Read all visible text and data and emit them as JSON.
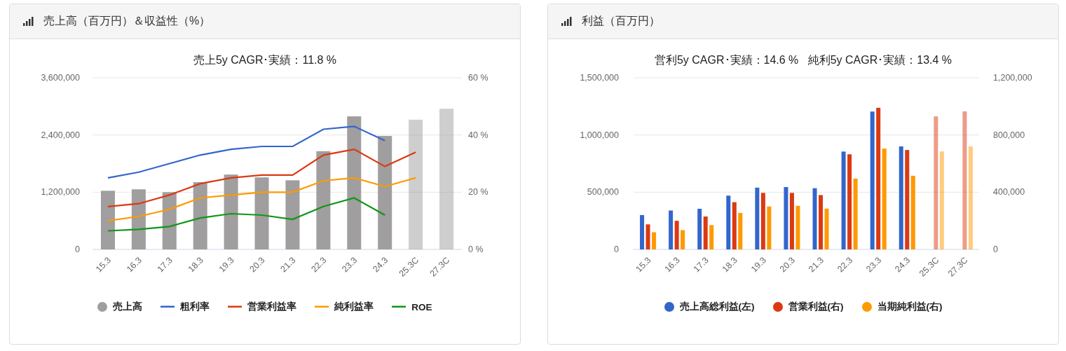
{
  "panels": [
    {
      "title": "売上高（百万円）＆収益性（%）",
      "forecast": [
        false,
        false,
        false,
        false,
        false,
        false,
        false,
        false,
        false,
        false,
        true,
        true
      ],
      "chart_data": {
        "type": "bar",
        "stacked": false,
        "title": "売上5y CAGR･実績：11.8 %",
        "categories": [
          "15.3",
          "16.3",
          "17.3",
          "18.3",
          "19.3",
          "20.3",
          "21.3",
          "22.3",
          "23.3",
          "24.3",
          "25.3C",
          "27.3C"
        ],
        "ylim": [
          0,
          3600000
        ],
        "yticks": [
          {
            "value": 0,
            "label": "0"
          },
          {
            "value": 1200000,
            "label": "1,200,000"
          },
          {
            "value": 2400000,
            "label": "2,400,000"
          },
          {
            "value": 3600000,
            "label": "3,600,000"
          }
        ],
        "y2lim": [
          0,
          60
        ],
        "y2ticks": [
          {
            "value": 0,
            "label": "0 %"
          },
          {
            "value": 20,
            "label": "20 %"
          },
          {
            "value": 40,
            "label": "40 %"
          },
          {
            "value": 60,
            "label": "60 %"
          }
        ],
        "series": [
          {
            "name": "売上高",
            "color": "#a09e9e",
            "type": "bar",
            "values": [
              1230000,
              1260000,
              1200000,
              1410000,
              1570000,
              1510000,
              1450000,
              2060000,
              2790000,
              2380000,
              2720000,
              2950000
            ]
          },
          {
            "name": "粗利率",
            "color": "#3366cc",
            "type": "line",
            "axis": "y2",
            "values": [
              25,
              27,
              30,
              33,
              35,
              36,
              36,
              42,
              43,
              38,
              null,
              null
            ]
          },
          {
            "name": "営業利益率",
            "color": "#dc3912",
            "type": "line",
            "axis": "y2",
            "values": [
              15,
              16,
              19,
              23,
              25,
              26,
              26,
              33,
              35,
              29,
              34,
              null
            ]
          },
          {
            "name": "純利益率",
            "color": "#ff9900",
            "type": "line",
            "axis": "y2",
            "values": [
              10,
              11.5,
              14,
              18,
              19,
              20,
              20,
              24,
              25,
              22,
              25,
              null
            ]
          },
          {
            "name": "ROE",
            "color": "#109618",
            "type": "line",
            "axis": "y2",
            "values": [
              6.5,
              7,
              8,
              11,
              12.5,
              12,
              10.5,
              15,
              18,
              12,
              null,
              null
            ]
          }
        ]
      }
    },
    {
      "title": "利益（百万円）",
      "forecast": [
        false,
        false,
        false,
        false,
        false,
        false,
        false,
        false,
        false,
        false,
        true,
        true
      ],
      "chart_data": {
        "type": "bar",
        "stacked": false,
        "title": "営利5y CAGR･実績：14.6 %   純利5y CAGR･実績：13.4 %",
        "categories": [
          "15.3",
          "16.3",
          "17.3",
          "18.3",
          "19.3",
          "20.3",
          "21.3",
          "22.3",
          "23.3",
          "24.3",
          "25.3C",
          "27.3C"
        ],
        "ylim": [
          0,
          1500000
        ],
        "yticks": [
          {
            "value": 0,
            "label": "0"
          },
          {
            "value": 500000,
            "label": "500,000"
          },
          {
            "value": 1000000,
            "label": "1,000,000"
          },
          {
            "value": 1500000,
            "label": "1,500,000"
          }
        ],
        "y2lim": [
          0,
          1200000
        ],
        "y2ticks": [
          {
            "value": 0,
            "label": "0"
          },
          {
            "value": 400000,
            "label": "400,000"
          },
          {
            "value": 800000,
            "label": "800,000"
          },
          {
            "value": 1200000,
            "label": "1,200,000"
          }
        ],
        "series": [
          {
            "name": "売上高総利益(左)",
            "color": "#3366cc",
            "type": "bar",
            "values": [
              300000,
              340000,
              355000,
              470000,
              540000,
              545000,
              535000,
              855000,
              1205000,
              900000,
              null,
              null
            ]
          },
          {
            "name": "営業利益(右)",
            "color": "#dc3912",
            "type": "bar",
            "axis": "y2",
            "values": [
              175000,
              200000,
              230000,
              330000,
              395000,
              395000,
              380000,
              665000,
              990000,
              695000,
              930000,
              965000
            ]
          },
          {
            "name": "当期純利益(右)",
            "color": "#ff9900",
            "type": "bar",
            "axis": "y2",
            "values": [
              120000,
              135000,
              170000,
              255000,
              300000,
              305000,
              285000,
              495000,
              705000,
              515000,
              685000,
              720000
            ]
          }
        ]
      }
    }
  ]
}
